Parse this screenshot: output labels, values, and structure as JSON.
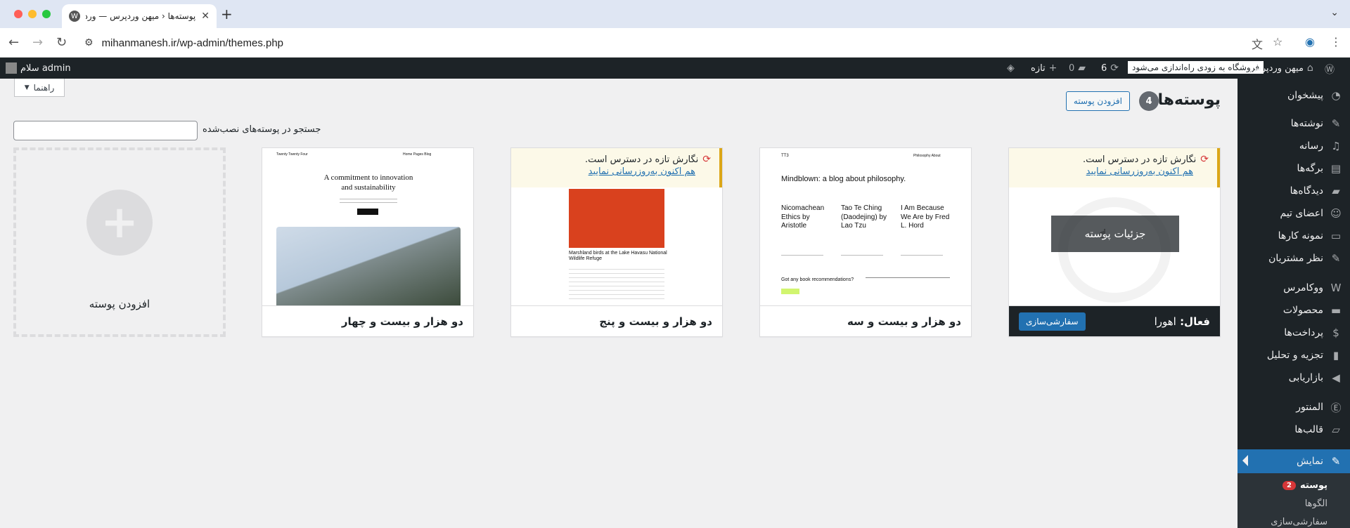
{
  "browser": {
    "tab_title": "پوسته‌ها ‹ میهن وردپرس — وردپرس",
    "url": "mihanmanesh.ir/wp-admin/themes.php"
  },
  "adminbar": {
    "greeting": "سلام admin",
    "site_name": "میهن وردپرس",
    "store_notice": "فروشگاه به زودی راه‌اندازی می‌شود",
    "updates_count": "6",
    "comments_count": "0",
    "new_label": "تازه"
  },
  "sidebar": {
    "items": [
      {
        "label": "پیشخوان",
        "icon": "dashboard-icon"
      },
      {
        "label": "نوشته‌ها",
        "icon": "pin-icon"
      },
      {
        "label": "رسانه",
        "icon": "media-icon"
      },
      {
        "label": "برگه‌ها",
        "icon": "page-icon"
      },
      {
        "label": "دیدگاه‌ها",
        "icon": "comment-icon"
      },
      {
        "label": "اعضای تیم",
        "icon": "team-icon"
      },
      {
        "label": "نمونه کارها",
        "icon": "portfolio-icon"
      },
      {
        "label": "نظر مشتریان",
        "icon": "pin-icon"
      },
      {
        "label": "ووکامرس",
        "icon": "woo-icon"
      },
      {
        "label": "محصولات",
        "icon": "products-icon"
      },
      {
        "label": "پرداخت‌ها",
        "icon": "payments-icon"
      },
      {
        "label": "تجزیه و تحلیل",
        "icon": "analytics-icon"
      },
      {
        "label": "بازاریابی",
        "icon": "megaphone-icon"
      },
      {
        "label": "المنتور",
        "icon": "elementor-icon"
      },
      {
        "label": "قالب‌ها",
        "icon": "templates-icon"
      },
      {
        "label": "نمایش",
        "icon": "appearance-icon"
      }
    ],
    "submenu": [
      {
        "label": "پوسته",
        "badge": "2"
      },
      {
        "label": "الگوها"
      },
      {
        "label": "سفارشی‌سازی"
      }
    ]
  },
  "main": {
    "help_label": "راهنما",
    "page_title": "پوسته‌ها",
    "theme_count": "4",
    "add_new_label": "افزودن پوسته",
    "search_label": "جستجو در پوسته‌های نصب‌شده",
    "update_notice": "نگارش تازه در دسترس است.",
    "update_link": "هم اکنون به‌روزرسانی نمایید",
    "active_prefix": "فعال:",
    "active_theme_name": "اهورا",
    "customize_label": "سفارشی‌سازی",
    "details_label": "جزئیات پوسته",
    "themes": [
      {
        "name": "دو هزار و بیست و سه"
      },
      {
        "name": "دو هزار و بیست و پنج"
      },
      {
        "name": "دو هزار و بیست و چهار"
      }
    ],
    "add_theme_label": "افزودن پوسته"
  },
  "previews": {
    "tt3_headline": "Mindblown: a blog about philosophy.",
    "tt3_col1": "Nicomachean Ethics by Aristotle",
    "tt3_col2": "Tao Te Ching (Daodejing) by Lao Tzu",
    "tt3_col3": "I Am Because We Are by Fred L. Hord",
    "tt3_question": "Got any book recommendations?",
    "tt5_caption": "Marshland birds at the Lake Havasu National Wildlife Refuge",
    "tt4_site": "Twenty Twenty Four",
    "tt4_headline": "A commitment to innovation and sustainability"
  },
  "colors": {
    "wp_blue": "#2271b1",
    "admin_dark": "#1d2327",
    "notice_yellow": "#dba617",
    "badge_red": "#d63638"
  }
}
